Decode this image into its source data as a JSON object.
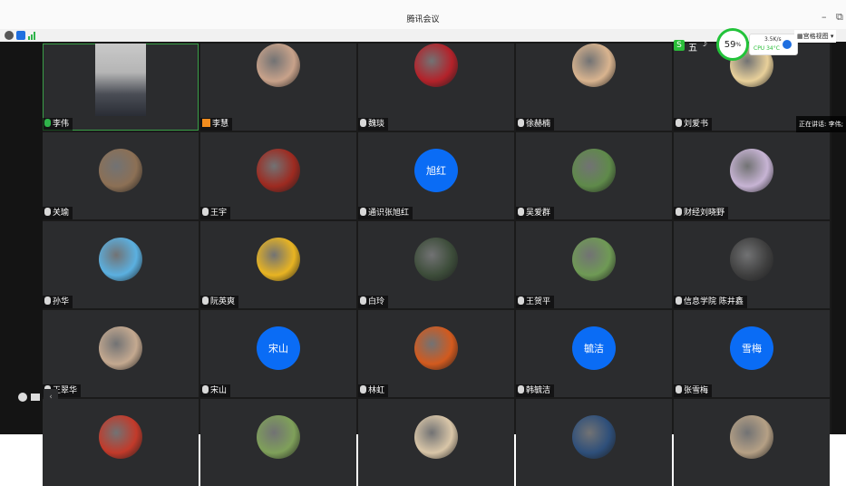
{
  "window": {
    "title": "腾讯会议",
    "minimize": "–",
    "restore": "⧉"
  },
  "overlay": {
    "ime": "五",
    "cpu_percent": "59",
    "percent_sign": "%",
    "net_speed": "3.5K/s",
    "cpu_temp": "CPU 34°C",
    "view_label": "宫格视图"
  },
  "speaking_now": "正在讲话: 李伟;",
  "participants": [
    {
      "name": "李伟",
      "mic": "on",
      "video": true,
      "color": "#5a5d66"
    },
    {
      "name": "李慧",
      "mic": "host",
      "color": "#c8a28a"
    },
    {
      "name": "魏琰",
      "mic": "muted",
      "color": "#b3222a"
    },
    {
      "name": "徐赫楠",
      "mic": "muted",
      "color": "#d9b48f"
    },
    {
      "name": "刘爱书",
      "mic": "muted",
      "color": "#e8d09a"
    },
    {
      "name": "关瑜",
      "mic": "muted",
      "color": "#8c7055"
    },
    {
      "name": "王宇",
      "mic": "muted",
      "color": "#9d2a20"
    },
    {
      "name": "通识张旭红",
      "mic": "muted",
      "initials": "旭红"
    },
    {
      "name": "吴爱群",
      "mic": "muted",
      "color": "#5f8a4a"
    },
    {
      "name": "财经刘晓野",
      "mic": "muted",
      "color": "#c7b4d4"
    },
    {
      "name": "孙华",
      "mic": "muted",
      "color": "#5bb0e0"
    },
    {
      "name": "阮英爽",
      "mic": "muted",
      "color": "#e8b422"
    },
    {
      "name": "白玲",
      "mic": "muted",
      "color": "#3d4d3a"
    },
    {
      "name": "王贺平",
      "mic": "muted",
      "color": "#6f9a55"
    },
    {
      "name": "信息学院 陈井鑫",
      "mic": "muted",
      "color": "#3f3f3f"
    },
    {
      "name": "王翠华",
      "mic": "muted",
      "color": "#c4a990"
    },
    {
      "name": "宋山",
      "mic": "muted",
      "initials": "宋山"
    },
    {
      "name": "林虹",
      "mic": "muted",
      "color": "#d25a1e"
    },
    {
      "name": "韩毓洁",
      "mic": "muted",
      "initials": "毓洁"
    },
    {
      "name": "张雪梅",
      "mic": "muted",
      "initials": "雪梅"
    },
    {
      "name": "",
      "mic": "none",
      "color": "#c23a2a"
    },
    {
      "name": "",
      "mic": "none",
      "color": "#7fa05a"
    },
    {
      "name": "",
      "mic": "none",
      "color": "#d9c6a8"
    },
    {
      "name": "",
      "mic": "none",
      "color": "#2e4f7a"
    },
    {
      "name": "",
      "mic": "none",
      "color": "#b5a085"
    }
  ],
  "colors": {
    "accent": "#0a6cf5",
    "active_border": "#3a9f48",
    "tile": "#2b2c2e"
  }
}
